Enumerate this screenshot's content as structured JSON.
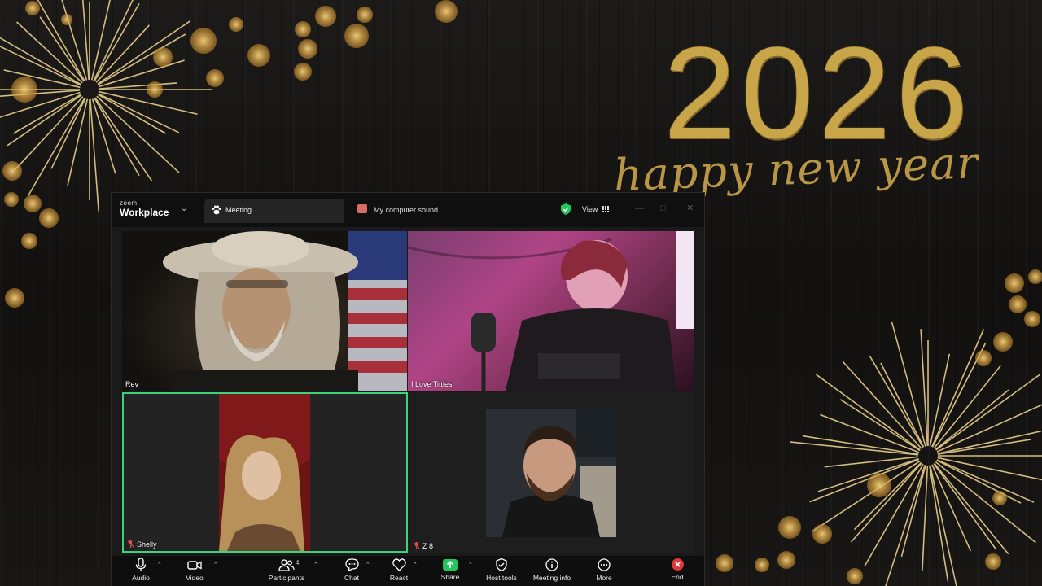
{
  "wallpaper": {
    "year": "2026",
    "greeting": "happy new year",
    "colors": {
      "gold": "#c9a54a",
      "wood": "#161513"
    }
  },
  "window": {
    "brand_small": "zoom",
    "brand_main": "Workplace",
    "tabs": [
      {
        "label": "Meeting",
        "icon": "paw-icon",
        "active": true
      },
      {
        "label": "My computer sound",
        "icon": "sound-icon",
        "active": false
      }
    ],
    "view_label": "View",
    "security_icon": "shield-check-icon",
    "window_controls": [
      "minimize",
      "maximize",
      "close"
    ]
  },
  "participants": [
    {
      "name": "Rev",
      "muted": false
    },
    {
      "name": "I Love Titties",
      "muted": false
    },
    {
      "name": "Shelly",
      "muted": true,
      "active_speaker": true
    },
    {
      "name": "Z 8",
      "muted": true
    }
  ],
  "toolbar": {
    "audio": "Audio",
    "video": "Video",
    "participants": "Participants",
    "participants_count": "4",
    "chat": "Chat",
    "react": "React",
    "share": "Share",
    "host_tools": "Host tools",
    "meeting_info": "Meeting info",
    "more": "More",
    "end": "End"
  },
  "accent_colors": {
    "active_speaker_border": "#3ed27a",
    "share": "#22c55e",
    "end": "#e23838",
    "muted": "#e05050"
  }
}
